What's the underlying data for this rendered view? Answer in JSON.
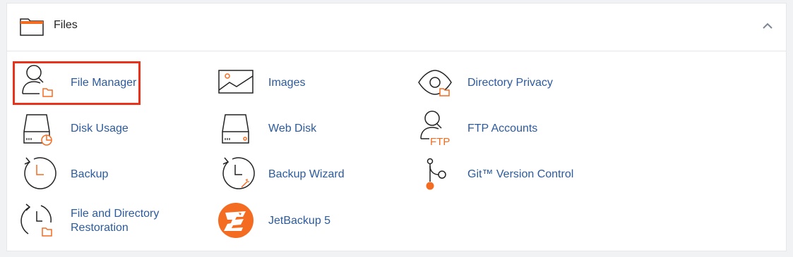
{
  "section": {
    "title": "Files",
    "collapse_icon": "chevron-up-icon",
    "folder_icon": "folder-icon"
  },
  "colors": {
    "link": "#2c5a9c",
    "accent": "#f36c21",
    "highlight": "#e8321c"
  },
  "items": [
    {
      "label": "File Manager",
      "icon": "file-manager-icon"
    },
    {
      "label": "Images",
      "icon": "images-icon"
    },
    {
      "label": "Directory Privacy",
      "icon": "directory-privacy-icon"
    },
    {
      "label": "Disk Usage",
      "icon": "disk-usage-icon"
    },
    {
      "label": "Web Disk",
      "icon": "web-disk-icon"
    },
    {
      "label": "FTP Accounts",
      "icon": "ftp-accounts-icon",
      "icon_text": "FTP"
    },
    {
      "label": "Backup",
      "icon": "backup-icon"
    },
    {
      "label": "Backup Wizard",
      "icon": "backup-wizard-icon"
    },
    {
      "label": "Git™ Version Control",
      "icon": "git-version-control-icon"
    },
    {
      "label_line1": "File and Directory",
      "label_line2": "Restoration",
      "icon": "file-directory-restoration-icon"
    },
    {
      "label": "JetBackup 5",
      "icon": "jetbackup-icon"
    }
  ]
}
